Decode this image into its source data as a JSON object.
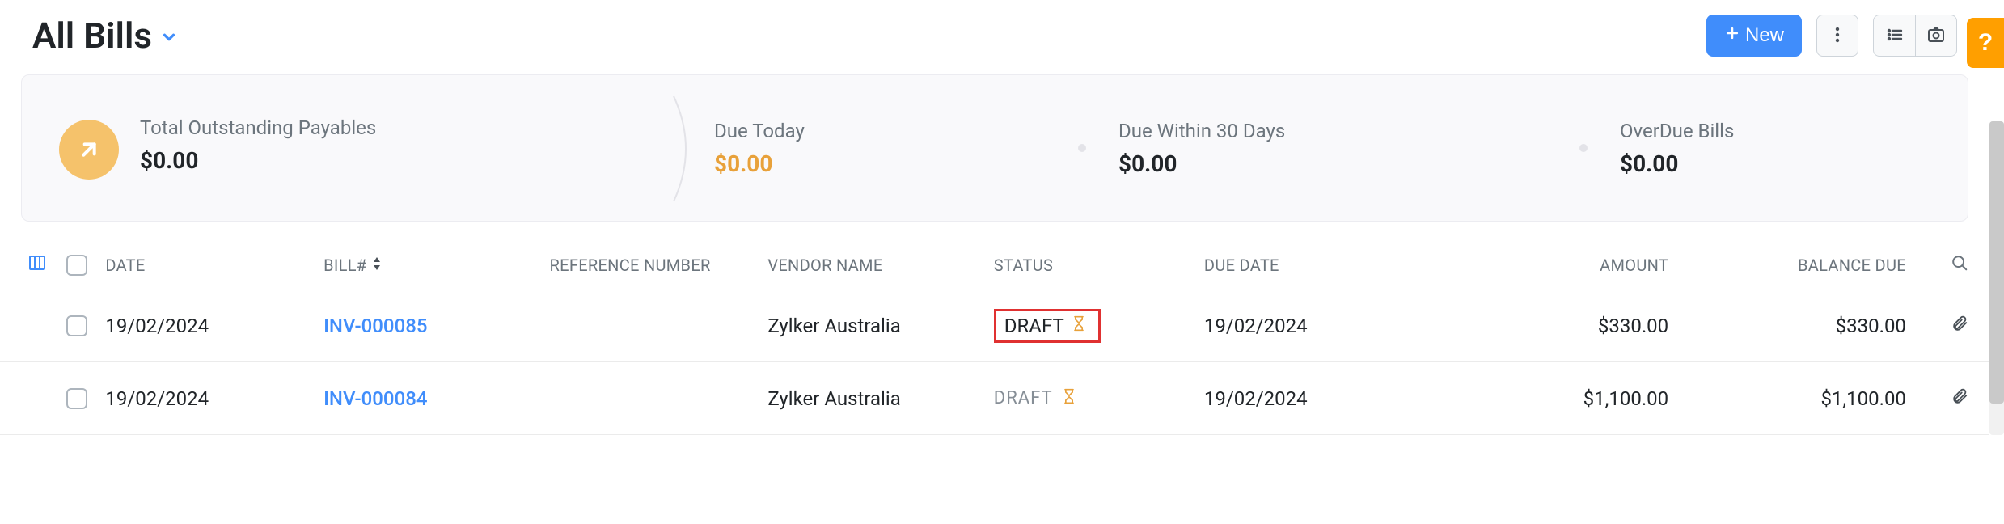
{
  "header": {
    "title": "All Bills",
    "new_button": "New"
  },
  "summary": {
    "outstanding": {
      "label": "Total Outstanding Payables",
      "value": "$0.00"
    },
    "due_today": {
      "label": "Due Today",
      "value": "$0.00"
    },
    "due_30": {
      "label": "Due Within 30 Days",
      "value": "$0.00"
    },
    "overdue": {
      "label": "OverDue Bills",
      "value": "$0.00"
    }
  },
  "columns": {
    "date": "DATE",
    "bill": "BILL#",
    "reference": "REFERENCE NUMBER",
    "vendor": "VENDOR NAME",
    "status": "STATUS",
    "due_date": "DUE DATE",
    "amount": "AMOUNT",
    "balance": "BALANCE DUE"
  },
  "rows": [
    {
      "date": "19/02/2024",
      "bill_no": "INV-000085",
      "reference": "",
      "vendor": "Zylker Australia",
      "status": "DRAFT",
      "due_date": "19/02/2024",
      "amount": "$330.00",
      "balance": "$330.00",
      "highlight": true
    },
    {
      "date": "19/02/2024",
      "bill_no": "INV-000084",
      "reference": "",
      "vendor": "Zylker Australia",
      "status": "DRAFT",
      "due_date": "19/02/2024",
      "amount": "$1,100.00",
      "balance": "$1,100.00",
      "highlight": false
    }
  ]
}
